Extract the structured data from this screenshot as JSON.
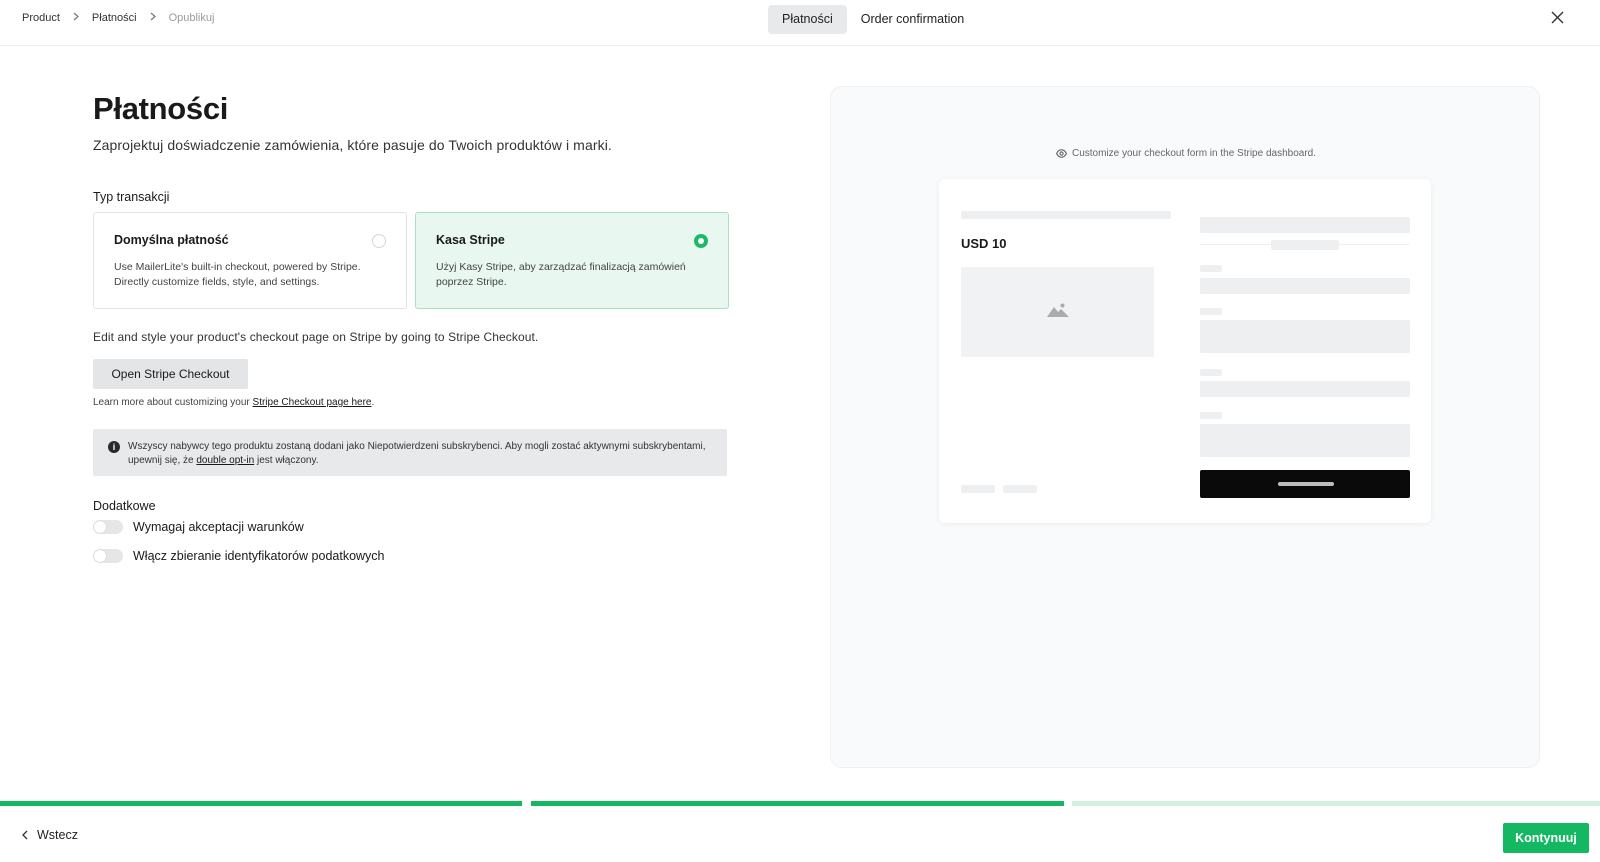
{
  "breadcrumb": {
    "items": [
      "Product",
      "Płatności",
      "Opublikuj"
    ]
  },
  "tabs": [
    {
      "label": "Płatności",
      "active": true
    },
    {
      "label": "Order confirmation",
      "active": false
    }
  ],
  "icons": {
    "close": "close-icon",
    "chevron": "chevron-right-icon",
    "info": "info-icon",
    "eye": "eye-icon",
    "image": "image-placeholder-icon",
    "back": "chevron-left-icon"
  },
  "main": {
    "title": "Płatności",
    "subtitle": "Zaprojektuj doświadczenie zamówienia, które pasuje do Twoich produktów i marki.",
    "transaction_label": "Typ transakcji",
    "options": [
      {
        "title": "Domyślna płatność",
        "description": "Use MailerLite's built-in checkout, powered by Stripe. Directly customize fields, style, and settings.",
        "selected": false
      },
      {
        "title": "Kasa Stripe",
        "description": "Użyj Kasy Stripe, aby zarządzać finalizacją zamówień poprzez Stripe.",
        "selected": true
      }
    ],
    "edit_text": "Edit and style your product's checkout page on Stripe by going to Stripe Checkout.",
    "open_button": "Open Stripe Checkout",
    "learn_prefix": "Learn more about customizing your ",
    "learn_link": "Stripe Checkout page here",
    "learn_suffix": ".",
    "info": {
      "prefix": "Wszyscy nabywcy tego produktu zostaną dodani jako Niepotwierdzeni subskrybenci. Aby mogli zostać aktywnymi subskrybentami, upewnij się, że ",
      "link": "double opt-in",
      "suffix": " jest włączony."
    },
    "extras_label": "Dodatkowe",
    "toggles": [
      {
        "label": "Wymagaj akceptacji warunków",
        "on": false
      },
      {
        "label": "Włącz zbieranie identyfikatorów podatkowych",
        "on": false
      }
    ]
  },
  "preview": {
    "hint": "Customize your checkout form in the Stripe dashboard.",
    "price": "USD 10"
  },
  "progress": {
    "steps": 3,
    "completed": 2,
    "colors": {
      "done": "#14b863",
      "pending": "#d3f1e0"
    }
  },
  "footer": {
    "back_label": "Wstecz",
    "continue_label": "Kontynuuj"
  },
  "colors": {
    "accent": "#14b863",
    "selected_card_bg": "#e8f7ef"
  }
}
